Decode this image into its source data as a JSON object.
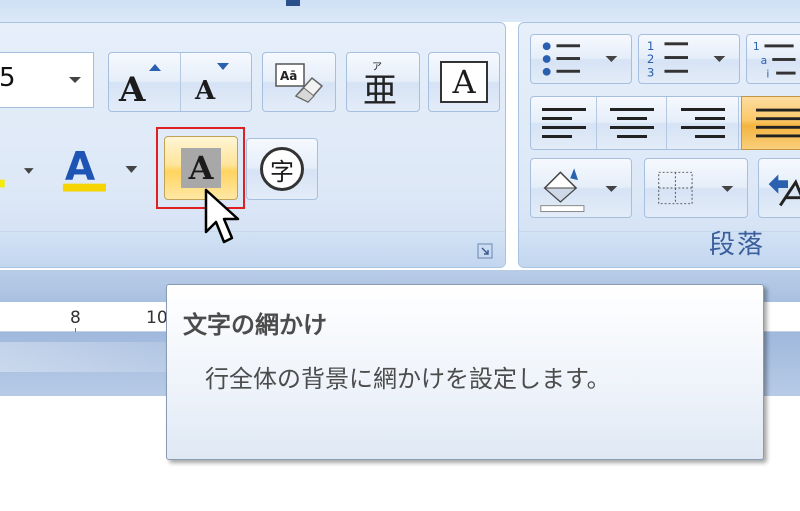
{
  "ribbon": {
    "font_group": {
      "font_size_value": "5",
      "grow_font_icon": "grow-font-icon",
      "shrink_font_icon": "shrink-font-icon",
      "clear_formatting_icon": "clear-formatting-icon",
      "phonetic_guide_label": "亜",
      "character_border_label": "A",
      "highlight_icon": "text-highlight-icon",
      "font_color_label": "A",
      "font_color_bar": "#f5d400",
      "character_shading_label": "A",
      "enclosed_character_label": "字"
    },
    "paragraph_group": {
      "label": "段落",
      "bullets_icon": "bullets-icon",
      "numbering_icon": "numbering-icon",
      "multilevel_icon": "multilevel-list-icon",
      "align_left_icon": "align-left-icon",
      "center_icon": "align-center-icon",
      "align_right_icon": "align-right-icon",
      "justify_icon": "justify-icon",
      "shading_icon": "paragraph-shading-icon",
      "borders_icon": "borders-icon"
    }
  },
  "ruler": {
    "numbers": [
      "8",
      "10"
    ]
  },
  "tooltip": {
    "title": "文字の網かけ",
    "body": "行全体の背景に網かけを設定します。"
  },
  "colors": {
    "accent_highlight": "#ffd35f",
    "selected": "#f5b440",
    "red_frame": "#e02020",
    "group_label": "#3a5f9c"
  }
}
